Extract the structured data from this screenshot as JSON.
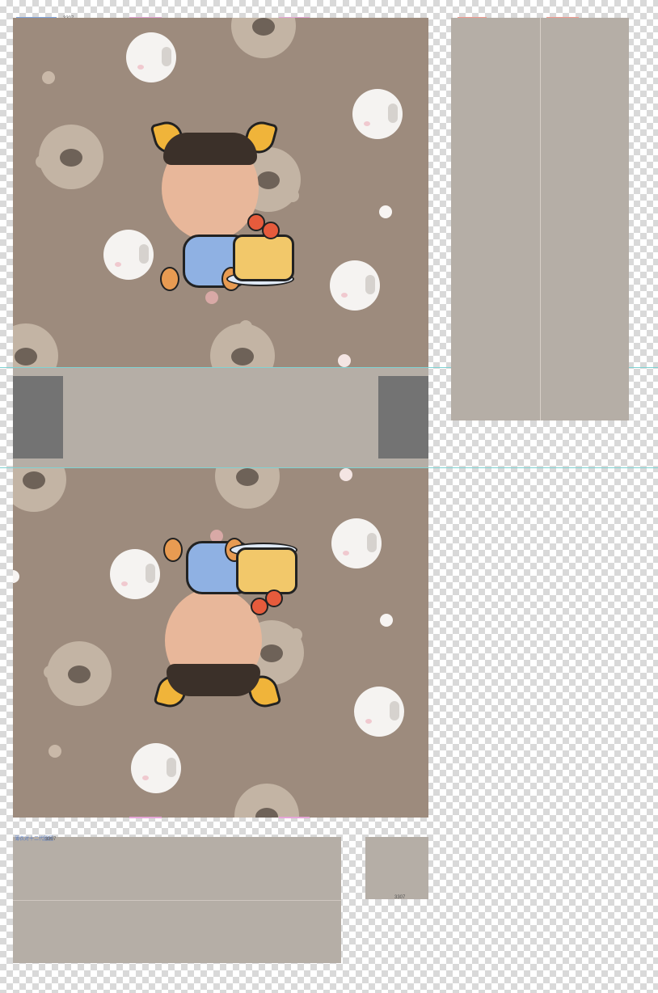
{
  "labels": {
    "top_left_code": "3307",
    "lower_left_label": "薄衣对十二代圆圈",
    "lower_left_code": "3307",
    "small_box_code": "3307"
  },
  "colors": {
    "panel_background": "#9d8b7d",
    "plain_panel": "#b5aea6",
    "dark_flap": "#737373",
    "guide_line": "#7fd3d3"
  },
  "pattern": {
    "motifs": [
      "bear-face-icon",
      "cat-face-icon",
      "dot"
    ]
  }
}
